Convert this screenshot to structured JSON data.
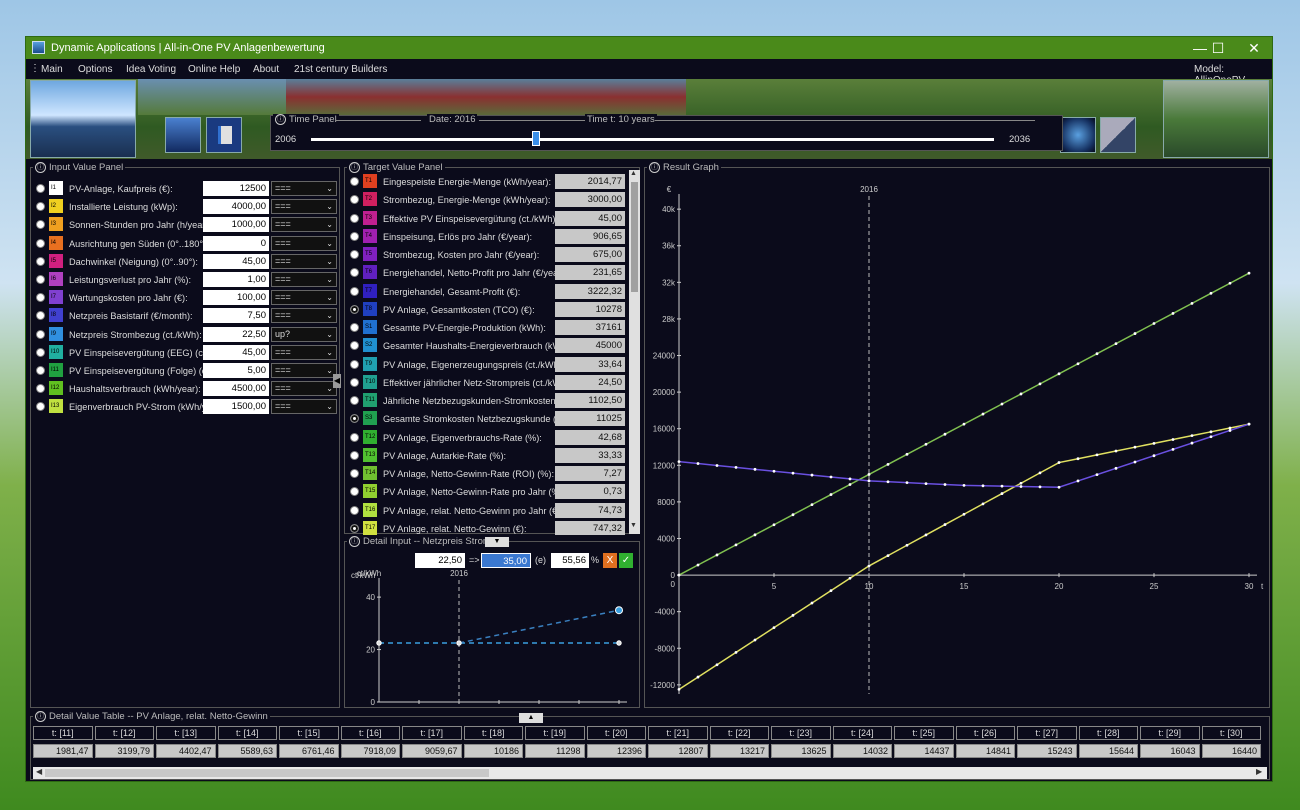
{
  "window": {
    "title": "Dynamic Applications | All-in-One PV Anlagenbewertung"
  },
  "menu": {
    "items": [
      "Main",
      "Options",
      "Idea Voting",
      "Online Help",
      "About",
      "21st century Builders"
    ],
    "model": "Model:  AllinOnePV"
  },
  "time_panel": {
    "title": "Time Panel",
    "date": "Date:  2016",
    "time": "Time t:  10  years",
    "start": "2006",
    "end": "2036",
    "slider_fraction": 0.33
  },
  "input_panel": {
    "title": "Input Value Panel",
    "rows": [
      {
        "icon": "I1",
        "color": "#ffffff",
        "label": "PV-Anlage, Kaufpreis (€):",
        "value": "12500",
        "mode": "==="
      },
      {
        "icon": "I2",
        "color": "#f0d020",
        "label": "Installierte Leistung (kWp):",
        "value": "4000,00",
        "mode": "==="
      },
      {
        "icon": "I3",
        "color": "#f0a020",
        "label": "Sonnen-Stunden pro Jahr (h/year):",
        "value": "1000,00",
        "mode": "==="
      },
      {
        "icon": "I4",
        "color": "#e87020",
        "label": "Ausrichtung gen Süden (0°..180°):",
        "value": "0",
        "mode": "==="
      },
      {
        "icon": "I5",
        "color": "#d02080",
        "label": "Dachwinkel (Neigung) (0°..90°):",
        "value": "45,00",
        "mode": "==="
      },
      {
        "icon": "I6",
        "color": "#b040c0",
        "label": "Leistungsverlust pro Jahr (%):",
        "value": "1,00",
        "mode": "==="
      },
      {
        "icon": "I7",
        "color": "#8040d0",
        "label": "Wartungskosten pro Jahr (€):",
        "value": "100,00",
        "mode": "==="
      },
      {
        "icon": "I8",
        "color": "#4040d0",
        "label": "Netzpreis Basistarif (€/month):",
        "value": "7,50",
        "mode": "==="
      },
      {
        "icon": "I9",
        "color": "#3090e0",
        "label": "Netzpreis Strombezug (ct./kWh):",
        "value": "22,50",
        "mode": "up?"
      },
      {
        "icon": "I10",
        "color": "#20b0a0",
        "label": "PV Einspeisevergütung (EEG) (ct./k",
        "value": "45,00",
        "mode": "==="
      },
      {
        "icon": "I11",
        "color": "#20a040",
        "label": "PV Einspeisevergütung (Folge) (ct./k",
        "value": "5,00",
        "mode": "==="
      },
      {
        "icon": "I12",
        "color": "#60c020",
        "label": "Haushaltsverbrauch (kWh/year):",
        "value": "4500,00",
        "mode": "==="
      },
      {
        "icon": "I13",
        "color": "#c0e040",
        "label": "Eigenverbrauch PV-Strom (kWh/yea",
        "value": "1500,00",
        "mode": "==="
      }
    ]
  },
  "target_panel": {
    "title": "Target Value Panel",
    "rows": [
      {
        "icon": "T1",
        "color": "#e04020",
        "label": "Eingespeiste Energie-Menge (kWh/year):",
        "value": "2014,77"
      },
      {
        "icon": "T2",
        "color": "#d02060",
        "label": "Strombezug, Energie-Menge (kWh/year):",
        "value": "3000,00"
      },
      {
        "icon": "T3",
        "color": "#c02090",
        "label": "Effektive PV Einspeisevergütung (ct./kWh):",
        "value": "45,00"
      },
      {
        "icon": "T4",
        "color": "#a020b0",
        "label": "Einspeisung, Erlös pro Jahr (€/year):",
        "value": "906,65"
      },
      {
        "icon": "T5",
        "color": "#8020c0",
        "label": "Strombezug, Kosten pro Jahr (€/year):",
        "value": "675,00"
      },
      {
        "icon": "T6",
        "color": "#6020c0",
        "label": "Energiehandel, Netto-Profit pro Jahr (€/year):",
        "value": "231,65"
      },
      {
        "icon": "T7",
        "color": "#3020c0",
        "label": "Energiehandel, Gesamt-Profit (€):",
        "value": "3222,32"
      },
      {
        "icon": "T8",
        "color": "#2040c0",
        "label": "PV Anlage, Gesamtkosten (TCO) (€):",
        "value": "10278"
      },
      {
        "icon": "S1",
        "color": "#2070d0",
        "label": "Gesamte PV-Energie-Produktion (kWh):",
        "value": "37161"
      },
      {
        "icon": "S2",
        "color": "#2090d0",
        "label": "Gesamter Haushalts-Energieverbrauch (kWh):",
        "value": "45000"
      },
      {
        "icon": "T9",
        "color": "#20a0b0",
        "label": "PV Anlage, Eigenerzeugungspreis (ct./kWh):",
        "value": "33,64"
      },
      {
        "icon": "T10",
        "color": "#20a090",
        "label": "Effektiver jährlicher Netz-Strompreis (ct./kWh):",
        "value": "24,50"
      },
      {
        "icon": "T11",
        "color": "#20a070",
        "label": "Jährliche Netzbezugskunden-Stromkosten (€/",
        "value": "1102,50"
      },
      {
        "icon": "S3",
        "color": "#20a050",
        "label": "Gesamte Stromkosten Netzbezugskunde (€):",
        "value": "11025"
      },
      {
        "icon": "T12",
        "color": "#30b030",
        "label": "PV Anlage, Eigenverbrauchs-Rate (%):",
        "value": "42,68"
      },
      {
        "icon": "T13",
        "color": "#50c030",
        "label": "PV Anlage, Autarkie-Rate (%):",
        "value": "33,33"
      },
      {
        "icon": "T14",
        "color": "#70c030",
        "label": "PV Anlage, Netto-Gewinn-Rate (ROI) (%):",
        "value": "7,27"
      },
      {
        "icon": "T15",
        "color": "#90d030",
        "label": "PV Anlage, Netto-Gewinn-Rate pro Jahr (%/ye",
        "value": "0,73"
      },
      {
        "icon": "T16",
        "color": "#b0e040",
        "label": "PV Anlage, relat. Netto-Gewinn pro Jahr (€/ye",
        "value": "74,73"
      },
      {
        "icon": "T17",
        "color": "#d0e040",
        "label": "PV Anlage, relat. Netto-Gewinn (€):",
        "value": "747,32"
      }
    ]
  },
  "detail_input": {
    "title": "Detail Input -- Netzpreis Strombez",
    "value_from": "22,50",
    "arrow": "=>",
    "value_to": "35,00",
    "unit_sym": "(e)",
    "percent": "55,56",
    "pct_sign": "%",
    "cancel": "X",
    "ok": "✓",
    "ylabel": "ct/kWh",
    "marker": "2016",
    "xlabel": "t"
  },
  "result_graph": {
    "title": "Result Graph",
    "ylabel": "€",
    "xlabel": "t",
    "marker": "2016"
  },
  "chart_data": [
    {
      "type": "line",
      "title": "Result Graph",
      "xlabel": "t",
      "ylabel": "€",
      "xlim": [
        0,
        30
      ],
      "ylim": [
        -13000,
        41000
      ],
      "yticks": [
        "40k",
        "36k",
        "32k",
        "28k",
        "24000",
        "20000",
        "16000",
        "12000",
        "8000",
        "4000",
        "0",
        "-4000",
        "-8000",
        "-12000"
      ],
      "xticks": [
        "5",
        "10",
        "15",
        "20",
        "25",
        "30"
      ],
      "series": [
        {
          "color": "#80c050",
          "x": [
            0,
            30
          ],
          "y": [
            0,
            33000
          ]
        },
        {
          "color": "#e0e060",
          "x": [
            0,
            10,
            20,
            30
          ],
          "y": [
            -12500,
            1000,
            12300,
            16500
          ]
        },
        {
          "color": "#6a50e0",
          "x": [
            0,
            10,
            15,
            20,
            30
          ],
          "y": [
            12400,
            10300,
            9800,
            9600,
            16500
          ]
        }
      ]
    },
    {
      "type": "line",
      "title": "Detail Input",
      "xlabel": "t",
      "ylabel": "ct/kWh",
      "xlim": [
        0,
        30
      ],
      "ylim": [
        0,
        45
      ],
      "yticks": [
        "40",
        "20",
        "0"
      ],
      "xticks": [
        "5",
        "10",
        "15",
        "20",
        "25",
        "30"
      ],
      "series": [
        {
          "color": "#3aa0e0",
          "x": [
            0,
            30
          ],
          "y": [
            22.5,
            22.5
          ]
        },
        {
          "color": "#3a80c0",
          "x": [
            10,
            30
          ],
          "y": [
            22.5,
            35
          ]
        }
      ]
    }
  ],
  "detail_table": {
    "title": "Detail Value Table -- PV Anlage, relat. Netto-Gewinn",
    "headers": [
      "t: [11]",
      "t: [12]",
      "t: [13]",
      "t: [14]",
      "t: [15]",
      "t: [16]",
      "t: [17]",
      "t: [18]",
      "t: [19]",
      "t: [20]",
      "t: [21]",
      "t: [22]",
      "t: [23]",
      "t: [24]",
      "t: [25]",
      "t: [26]",
      "t: [27]",
      "t: [28]",
      "t: [29]",
      "t: [30]"
    ],
    "values": [
      "1981,47",
      "3199,79",
      "4402,47",
      "5589,63",
      "6761,46",
      "7918,09",
      "9059,67",
      "10186",
      "11298",
      "12396",
      "12807",
      "13217",
      "13625",
      "14032",
      "14437",
      "14841",
      "15243",
      "15644",
      "16043",
      "16440"
    ]
  }
}
